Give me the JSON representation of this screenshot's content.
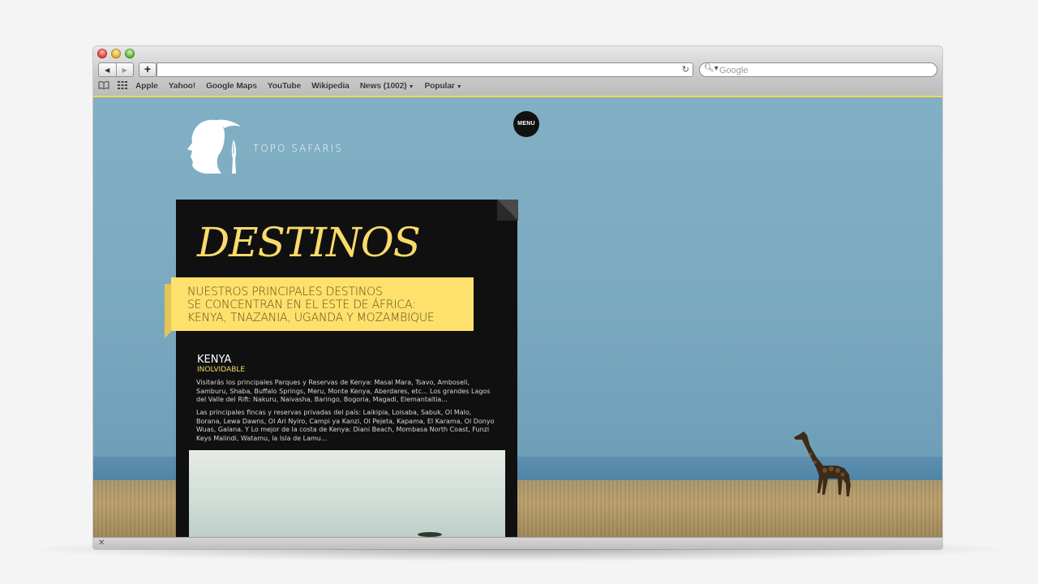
{
  "browser": {
    "search_placeholder": "Google",
    "address_value": "",
    "bookmarks": [
      {
        "label": "Apple"
      },
      {
        "label": "Yahoo!"
      },
      {
        "label": "Google Maps"
      },
      {
        "label": "YouTube"
      },
      {
        "label": "Wikipedia"
      },
      {
        "label": "News (1002)"
      },
      {
        "label": "Popular"
      }
    ]
  },
  "site": {
    "brand": "TOPO SAFARIS",
    "menu_label": "MENU"
  },
  "destinations": {
    "title": "DESTINOS",
    "intro_lines": [
      "NUESTROS PRINCIPALES DESTINOS",
      "SE CONCENTRAN EN EL ESTE DE ÁFRICA:",
      "KENYA, TNAZANIA, UGANDA Y MOZAMBIQUE"
    ],
    "kenya": {
      "name": "KENYA",
      "tagline": "INOLVIDABLE",
      "paragraph1": "Visitarás los principales Parques y Reservas de Kenya: Masai Mara, Tsavo, Amboseli, Samburu, Shaba, Buffalo Springs, Meru, Monte Kenya, Aberdares, etc... Los grandes Lagos del Valle del Rift: Nakuru, Naivasha, Baringo, Bogoria, Magadi, Elemantaitia...",
      "paragraph2": "Las principales fincas y reservas privadas del país: Laikipia, Loisaba, Sabuk, Ol Malo, Borana, Lewa Dawns, Ol Ari Nyiro, Campi ya Kanzi, Ol Pejeta, Kapama, El Karama, Ol Donyo Wuas, Galana. Y Lo mejor de la costa de Kenya: Diani Beach, Mombasa North Coast, Funzi Keys Malindi, Watamu, la Isla de Lamu..."
    }
  },
  "colors": {
    "accent_yellow": "#f8db6a",
    "ribbon_yellow": "#fde16c",
    "panel_black": "#101010",
    "sky_blue": "#7cabc1"
  },
  "icons": {
    "back": "back-arrow-icon",
    "forward": "forward-arrow-icon",
    "add": "plus-icon",
    "reload": "reload-icon",
    "search": "magnifier-icon",
    "reading_list": "book-icon",
    "top_sites": "grid-icon",
    "close": "close-icon"
  }
}
